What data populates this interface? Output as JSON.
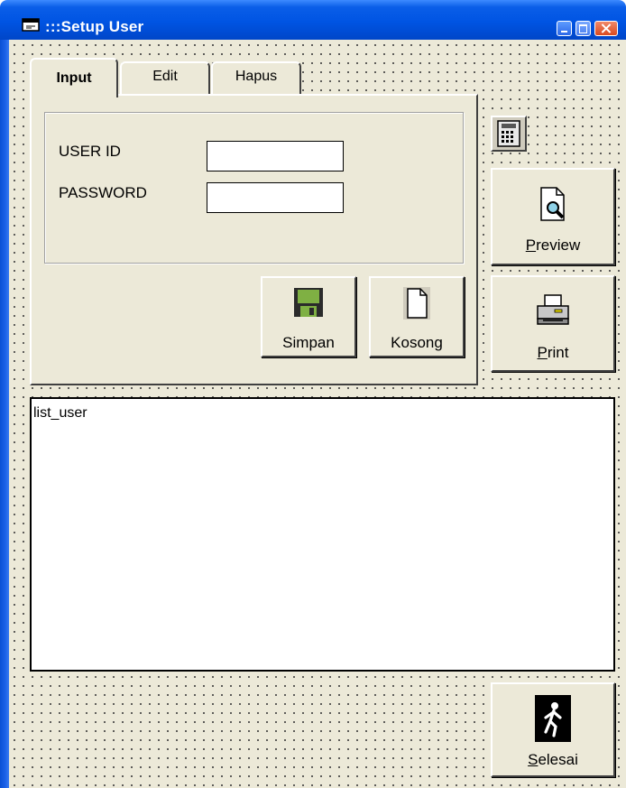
{
  "window": {
    "title": ":::Setup User"
  },
  "tabs": [
    {
      "label": "Input",
      "active": true
    },
    {
      "label": "Edit",
      "active": false
    },
    {
      "label": "Hapus",
      "active": false
    }
  ],
  "form": {
    "user_id_label": "USER ID",
    "user_id_value": "",
    "password_label": "PASSWORD",
    "password_value": ""
  },
  "buttons": {
    "simpan": "Simpan",
    "kosong": "Kosong",
    "preview_hotkey": "P",
    "preview_rest": "review",
    "print_hotkey": "P",
    "print_rest": "rint",
    "selesai_hotkey": "S",
    "selesai_rest": "elesai"
  },
  "list": {
    "text": "list_user"
  },
  "icons": [
    "window-icon",
    "minimize-icon",
    "maximize-icon",
    "close-icon",
    "floppy-disk-icon",
    "blank-document-icon",
    "calculator-icon",
    "print-preview-icon",
    "printer-icon",
    "exit-walking-man-icon"
  ]
}
